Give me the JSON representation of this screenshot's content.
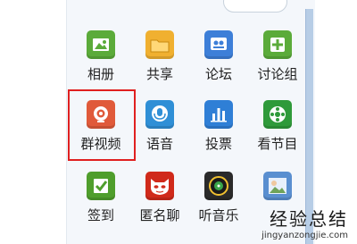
{
  "apps": [
    {
      "label": "相册",
      "icon": "photo-album-icon",
      "color": "#5bab3a"
    },
    {
      "label": "共享",
      "icon": "folder-icon",
      "color": "#f0b030"
    },
    {
      "label": "论坛",
      "icon": "forum-icon",
      "color": "#3d7fd8"
    },
    {
      "label": "讨论组",
      "icon": "discussion-group-icon",
      "color": "#5bab3a"
    },
    {
      "label": "群视频",
      "icon": "group-video-icon",
      "color": "#e05a3a"
    },
    {
      "label": "语音",
      "icon": "voice-icon",
      "color": "#2f8fd6"
    },
    {
      "label": "投票",
      "icon": "vote-icon",
      "color": "#2f7fd6"
    },
    {
      "label": "看节目",
      "icon": "watch-show-icon",
      "color": "#2f9a3a"
    },
    {
      "label": "签到",
      "icon": "check-in-icon",
      "color": "#4f9e2c"
    },
    {
      "label": "匿名聊",
      "icon": "anonymous-chat-icon",
      "color": "#d02a1a"
    },
    {
      "label": "听音乐",
      "icon": "music-icon",
      "color": "#2a2a2a"
    },
    {
      "label": "",
      "icon": "image-icon",
      "color": "#5a8fd0"
    }
  ],
  "watermark": {
    "main": "经验总结",
    "sub": "jingyanzongjie.com"
  }
}
